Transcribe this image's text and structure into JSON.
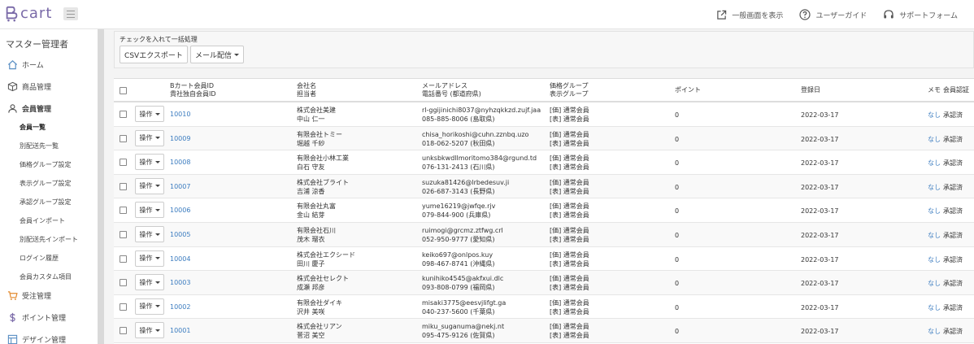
{
  "brand": {
    "logo_text": "cart"
  },
  "header": {
    "links": [
      {
        "label": "一般画面を表示",
        "icon": "external-link-icon"
      },
      {
        "label": "ユーザーガイド",
        "icon": "help-circle-icon"
      },
      {
        "label": "サポートフォーム",
        "icon": "headset-icon"
      }
    ]
  },
  "sidebar": {
    "title": "マスター管理者",
    "items": [
      {
        "label": "ホーム",
        "icon": "home-icon"
      },
      {
        "label": "商品管理",
        "icon": "box-icon"
      },
      {
        "label": "会員管理",
        "icon": "user-icon"
      },
      {
        "label": "受注管理",
        "icon": "cart-icon"
      },
      {
        "label": "ポイント管理",
        "icon": "dollar-icon"
      },
      {
        "label": "デザイン管理",
        "icon": "layout-icon"
      }
    ],
    "subitems": [
      "会員一覧",
      "別配送先一覧",
      "価格グループ設定",
      "表示グループ設定",
      "承認グループ設定",
      "会員インポート",
      "別配送先インポート",
      "ログイン履歴",
      "会員カスタム項目"
    ]
  },
  "batch": {
    "label": "チェックを入れて一括処理",
    "csv_button": "CSVエクスポート",
    "mail_button": "メール配信"
  },
  "table": {
    "headers": {
      "id_line1": "Bカート会員ID",
      "id_line2": "貴社独自会員ID",
      "company_line1": "会社名",
      "company_line2": "担当者",
      "email_line1": "メールアドレス",
      "email_line2": "電話番号 (都道府県)",
      "group_line1": "価格グループ",
      "group_line2": "表示グループ",
      "points": "ポイント",
      "registered": "登録日",
      "memo": "メモ",
      "approval": "会員認証"
    },
    "op_label": "操作",
    "rows": [
      {
        "id": "10010",
        "company": "株式会社美建",
        "person": "中山 仁一",
        "email": "rl-ggijinichi8037@nyhzqkkzd.zujf.jaa",
        "phone": "085-885-8006 (島取県)",
        "price_group": "[価] 通常会員",
        "display_group": "[表] 通常会員",
        "points": "0",
        "date": "2022-03-17",
        "memo": "なし",
        "status": "承認済"
      },
      {
        "id": "10009",
        "company": "有限会社トミー",
        "person": "堀越 千紗",
        "email": "chisa_horikoshi@cuhn.zznbq.uzo",
        "phone": "018-062-5207 (秋田県)",
        "price_group": "[価] 通常会員",
        "display_group": "[表] 通常会員",
        "points": "0",
        "date": "2022-03-17",
        "memo": "なし",
        "status": "承認済"
      },
      {
        "id": "10008",
        "company": "有限会社小林工業",
        "person": "白石 守友",
        "email": "unksbkwdllmoritomo384@rgund.td",
        "phone": "076-131-2413 (石川県)",
        "price_group": "[価] 通常会員",
        "display_group": "[表] 通常会員",
        "points": "0",
        "date": "2022-03-17",
        "memo": "なし",
        "status": "承認済"
      },
      {
        "id": "10007",
        "company": "株式会社ブライト",
        "person": "吉浦 涼香",
        "email": "suzuka81426@lrbedesuv.ji",
        "phone": "026-687-3143 (長野県)",
        "price_group": "[価] 通常会員",
        "display_group": "[表] 通常会員",
        "points": "0",
        "date": "2022-03-17",
        "memo": "なし",
        "status": "承認済"
      },
      {
        "id": "10006",
        "company": "有限会社丸富",
        "person": "金山 結芽",
        "email": "yume16219@jwfqe.rjv",
        "phone": "079-844-900 (兵庫県)",
        "price_group": "[価] 通常会員",
        "display_group": "[表] 通常会員",
        "points": "0",
        "date": "2022-03-17",
        "memo": "なし",
        "status": "承認済"
      },
      {
        "id": "10005",
        "company": "有限会社石川",
        "person": "茂木 瑠衣",
        "email": "ruimogi@grcmz.ztfwg.crl",
        "phone": "052-950-9777 (愛知県)",
        "price_group": "[価] 通常会員",
        "display_group": "[表] 通常会員",
        "points": "0",
        "date": "2022-03-17",
        "memo": "なし",
        "status": "承認済"
      },
      {
        "id": "10004",
        "company": "株式会社エクシード",
        "person": "田川 慶子",
        "email": "keiko697@onlpos.kuy",
        "phone": "098-467-8741 (沖縄県)",
        "price_group": "[価] 通常会員",
        "display_group": "[表] 通常会員",
        "points": "0",
        "date": "2022-03-17",
        "memo": "なし",
        "status": "承認済"
      },
      {
        "id": "10003",
        "company": "株式会社セレクト",
        "person": "成瀬 邦彦",
        "email": "kunihiko4545@akfxui.dlc",
        "phone": "093-808-0799 (福岡県)",
        "price_group": "[価] 通常会員",
        "display_group": "[表] 通常会員",
        "points": "0",
        "date": "2022-03-17",
        "memo": "なし",
        "status": "承認済"
      },
      {
        "id": "10002",
        "company": "有限会社ダイキ",
        "person": "沢井 美咲",
        "email": "misaki3775@eesvjlifgt.ga",
        "phone": "040-237-5600 (千葉県)",
        "price_group": "[価] 通常会員",
        "display_group": "[表] 通常会員",
        "points": "0",
        "date": "2022-03-17",
        "memo": "なし",
        "status": "承認済"
      },
      {
        "id": "10001",
        "company": "株式会社リアン",
        "person": "菅沼 美空",
        "email": "miku_suganuma@nekj.nt",
        "phone": "095-475-9126 (佐賀県)",
        "price_group": "[価] 通常会員",
        "display_group": "[表] 通常会員",
        "points": "0",
        "date": "2022-03-17",
        "memo": "なし",
        "status": "承認済"
      }
    ]
  },
  "colors": {
    "accent": "#3a7bbf",
    "logo": "#7a6aa8",
    "cart_icon": "#e38a2e"
  }
}
